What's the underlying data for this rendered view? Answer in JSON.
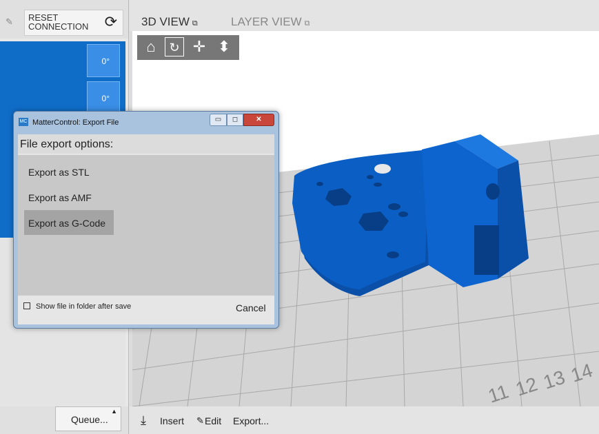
{
  "left_panel": {
    "reset_label": "RESET\nCONNECTION",
    "angle_values": [
      "0°",
      "0°"
    ],
    "queue_label": "Queue..."
  },
  "tabs": {
    "view3d": "3D VIEW",
    "layer_view": "LAYER VIEW"
  },
  "toolbar": {
    "insert": "Insert",
    "edit": "Edit",
    "export": "Export..."
  },
  "dialog": {
    "title": "MatterControl: Export File",
    "app_icon_text": "MC",
    "heading": "File export options:",
    "options": [
      "Export as STL",
      "Export as AMF",
      "Export as G-Code"
    ],
    "selected_option": "Export as G-Code",
    "show_folder_label": "Show file in folder after save",
    "show_folder_checked": false,
    "cancel_label": "Cancel"
  },
  "bed_numbers": [
    "11",
    "12",
    "13",
    "14"
  ],
  "colors": {
    "part_blue": "#0b5fc4",
    "panel_blue": "#0f6dc8",
    "dialog_frame": "#a9c3de"
  }
}
